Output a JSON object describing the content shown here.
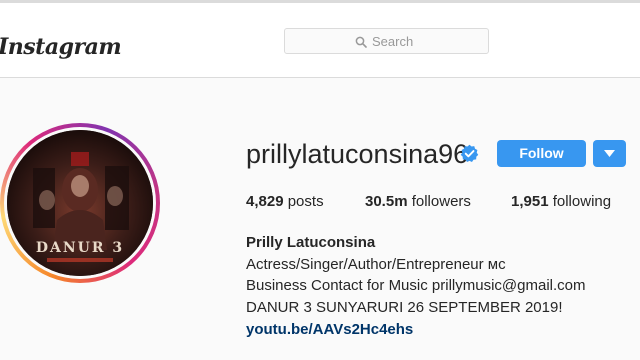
{
  "header": {
    "logo_text": "Instagram",
    "search": {
      "placeholder": "Search",
      "icon": "search-icon"
    }
  },
  "profile": {
    "avatar_poster_title": "DANUR 3",
    "username": "prillylatuconsina96",
    "verified_icon": "verified-badge-icon",
    "follow_label": "Follow",
    "dropdown_icon": "chevron-down-icon",
    "stats": {
      "posts_count": "4,829",
      "posts_label": "posts",
      "followers_count": "30.5m",
      "followers_label": "followers",
      "following_count": "1,951",
      "following_label": "following"
    },
    "bio": {
      "full_name": "Prilly Latuconsina",
      "line1": "Actress/Singer/Author/Entrepreneur ᴍᴄ",
      "line2": "Business Contact for Music prillymusic@gmail.com",
      "line3": "DANUR 3 SUNYARURI 26 SEPTEMBER 2019!",
      "link": "youtu.be/AAVs2Hc4ehs"
    }
  },
  "colors": {
    "accent": "#3897f0",
    "link": "#003569",
    "text": "#262626",
    "background": "#fafafa",
    "border": "#dbdbdb"
  }
}
